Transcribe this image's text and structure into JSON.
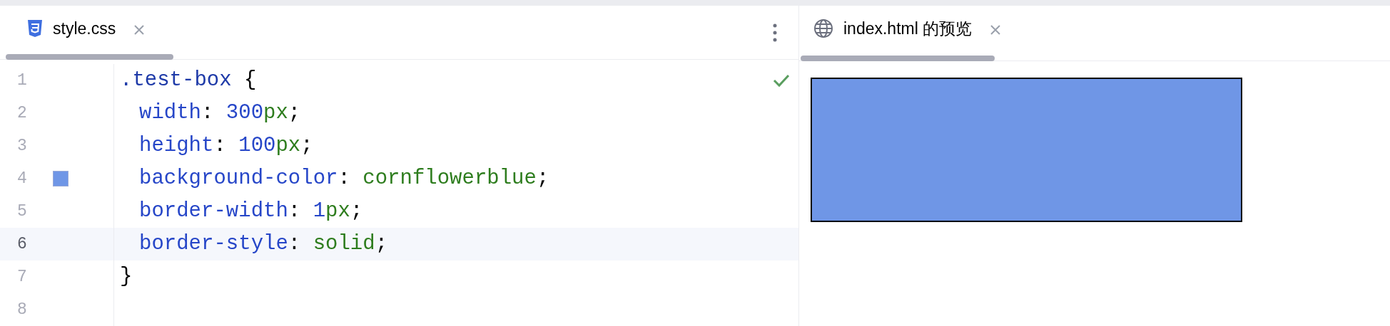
{
  "editor_tab": {
    "label": "style.css",
    "selected": true
  },
  "preview_tab": {
    "label": "index.html 的预览",
    "selected": true
  },
  "lines": [
    {
      "number": "1",
      "current": false,
      "indented": false,
      "tokens": [
        {
          "kind": "selector",
          "text": ".test-box"
        },
        {
          "kind": "punct",
          "text": " {"
        }
      ]
    },
    {
      "number": "2",
      "current": false,
      "indented": true,
      "tokens": [
        {
          "kind": "prop",
          "text": "width"
        },
        {
          "kind": "punct",
          "text": ": "
        },
        {
          "kind": "number",
          "text": "300"
        },
        {
          "kind": "unit",
          "text": "px"
        },
        {
          "kind": "punct",
          "text": ";"
        }
      ]
    },
    {
      "number": "3",
      "current": false,
      "indented": true,
      "tokens": [
        {
          "kind": "prop",
          "text": "height"
        },
        {
          "kind": "punct",
          "text": ": "
        },
        {
          "kind": "number",
          "text": "100"
        },
        {
          "kind": "unit",
          "text": "px"
        },
        {
          "kind": "punct",
          "text": ";"
        }
      ]
    },
    {
      "number": "4",
      "current": false,
      "indented": true,
      "swatch": {
        "color": "#6f96e6"
      },
      "tokens": [
        {
          "kind": "prop",
          "text": "background-color"
        },
        {
          "kind": "punct",
          "text": ": "
        },
        {
          "kind": "value",
          "text": "cornflowerblue"
        },
        {
          "kind": "punct",
          "text": ";"
        }
      ]
    },
    {
      "number": "5",
      "current": false,
      "indented": true,
      "tokens": [
        {
          "kind": "prop",
          "text": "border-width"
        },
        {
          "kind": "punct",
          "text": ": "
        },
        {
          "kind": "number",
          "text": "1"
        },
        {
          "kind": "unit",
          "text": "px"
        },
        {
          "kind": "punct",
          "text": ";"
        }
      ]
    },
    {
      "number": "6",
      "current": true,
      "indented": true,
      "tokens": [
        {
          "kind": "prop",
          "text": "border-style"
        },
        {
          "kind": "punct",
          "text": ": "
        },
        {
          "kind": "value",
          "text": "solid"
        },
        {
          "kind": "punct",
          "text": ";"
        }
      ]
    },
    {
      "number": "7",
      "current": false,
      "indented": false,
      "tokens": [
        {
          "kind": "punct",
          "text": "}"
        }
      ]
    },
    {
      "number": "8",
      "current": false
    }
  ]
}
